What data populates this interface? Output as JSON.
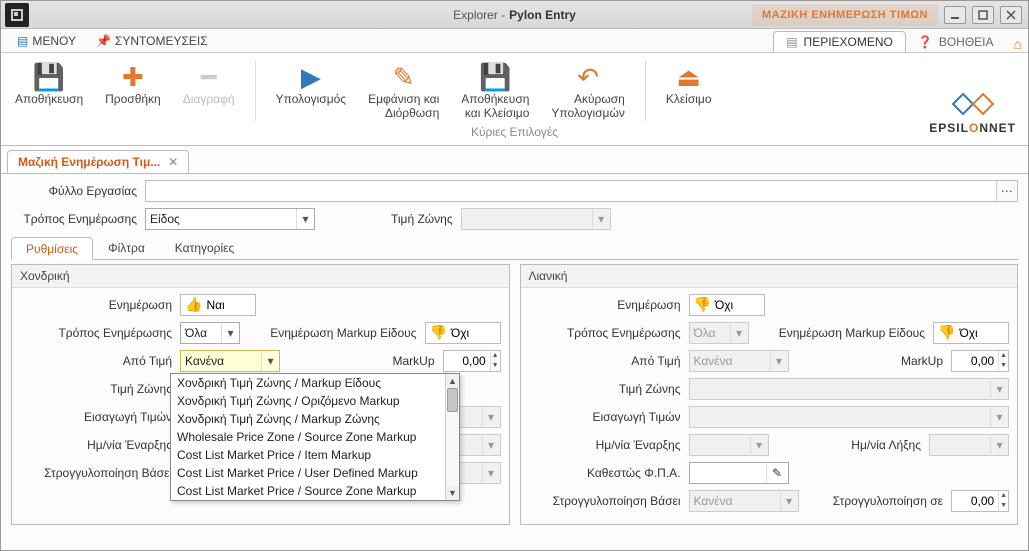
{
  "titlebar": {
    "explorer": "Explorer -",
    "app": "Pylon Entry",
    "headline": "ΜΑΖΙΚΗ ΕΝΗΜΕΡΩΣΗ ΤΙΜΩΝ"
  },
  "menu": {
    "main": "ΜΕΝΟΥ",
    "shortcuts": "ΣΥΝΤΟΜΕΥΣΕΙΣ",
    "content_tab": "ΠΕΡΙΕΧΟΜΕΝΟ",
    "help_tab": "ΒΟΗΘΕΙΑ"
  },
  "ribbon": {
    "save": "Αποθήκευση",
    "add": "Προσθήκη",
    "delete": "Διαγραφή",
    "calc": "Υπολογισμός",
    "show_fix": "Εμφάνιση και\nΔιόρθωση",
    "save_close": "Αποθήκευση\nκαι Κλείσιμο",
    "cancel_calc": "Ακύρωση\nΥπολογισμών",
    "close": "Κλείσιμο",
    "group_label": "Κύριες Επιλογές"
  },
  "brand": {
    "name_a": "EPSIL",
    "name_o": "O",
    "name_b": "NNET"
  },
  "doc_tab": {
    "label": "Μαζική Ενημέρωση Τιμ..."
  },
  "header_form": {
    "worksheet_label": "Φύλλο Εργασίας",
    "update_mode_label": "Τρόπος Ενημέρωσης",
    "update_mode_value": "Είδος",
    "zone_price_label": "Τιμή Ζώνης"
  },
  "sub_tabs": {
    "settings": "Ρυθμίσεις",
    "filters": "Φίλτρα",
    "categories": "Κατηγορίες"
  },
  "wholesale": {
    "title": "Χονδρική",
    "update_label": "Ενημέρωση",
    "update_val": "Ναι",
    "update_mode_label": "Τρόπος Ενημέρωσης",
    "update_mode_val": "Όλα",
    "markup_species_label": "Ενημέρωση Markup Είδους",
    "markup_species_val": "Όχι",
    "from_price_label": "Από Τιμή",
    "from_price_val": "Κανένα",
    "markup_label": "MarkUp",
    "markup_val": "0,00",
    "zone_price_label": "Τιμή Ζώνης",
    "import_prices_label": "Εισαγωγή Τιμών",
    "start_date_label": "Ημ/νία Έναρξης",
    "rounding_base_label": "Στρογγυλοποίηση Βάσει",
    "dropdown": [
      "Χονδρική Τιμή Ζώνης / Markup Είδους",
      "Χονδρική Τιμή Ζώνης / Οριζόμενο Markup",
      "Χονδρική Τιμή Ζώνης / Markup Ζώνης",
      "Wholesale Price Zone / Source Zone Markup",
      "Cost List Market Price / Item Markup",
      "Cost List Market Price / User Defined Markup",
      "Cost List Market Price / Source Zone Markup"
    ]
  },
  "retail": {
    "title": "Λιανική",
    "update_label": "Ενημέρωση",
    "update_val": "Όχι",
    "update_mode_label": "Τρόπος Ενημέρωσης",
    "update_mode_val": "Όλα",
    "markup_species_label": "Ενημέρωση Markup Είδους",
    "markup_species_val": "Όχι",
    "from_price_label": "Από Τιμή",
    "from_price_val": "Κανένα",
    "markup_label": "MarkUp",
    "markup_val": "0,00",
    "zone_price_label": "Τιμή Ζώνης",
    "import_prices_label": "Εισαγωγή Τιμών",
    "start_date_label": "Ημ/νία Έναρξης",
    "end_date_label": "Ημ/νία Λήξης",
    "vat_status_label": "Καθεστώς Φ.Π.Α.",
    "rounding_base_label": "Στρογγυλοποίηση Βάσει",
    "rounding_base_val": "Κανένα",
    "rounding_to_label": "Στρογγυλοποίηση σε",
    "rounding_to_val": "0,00"
  }
}
